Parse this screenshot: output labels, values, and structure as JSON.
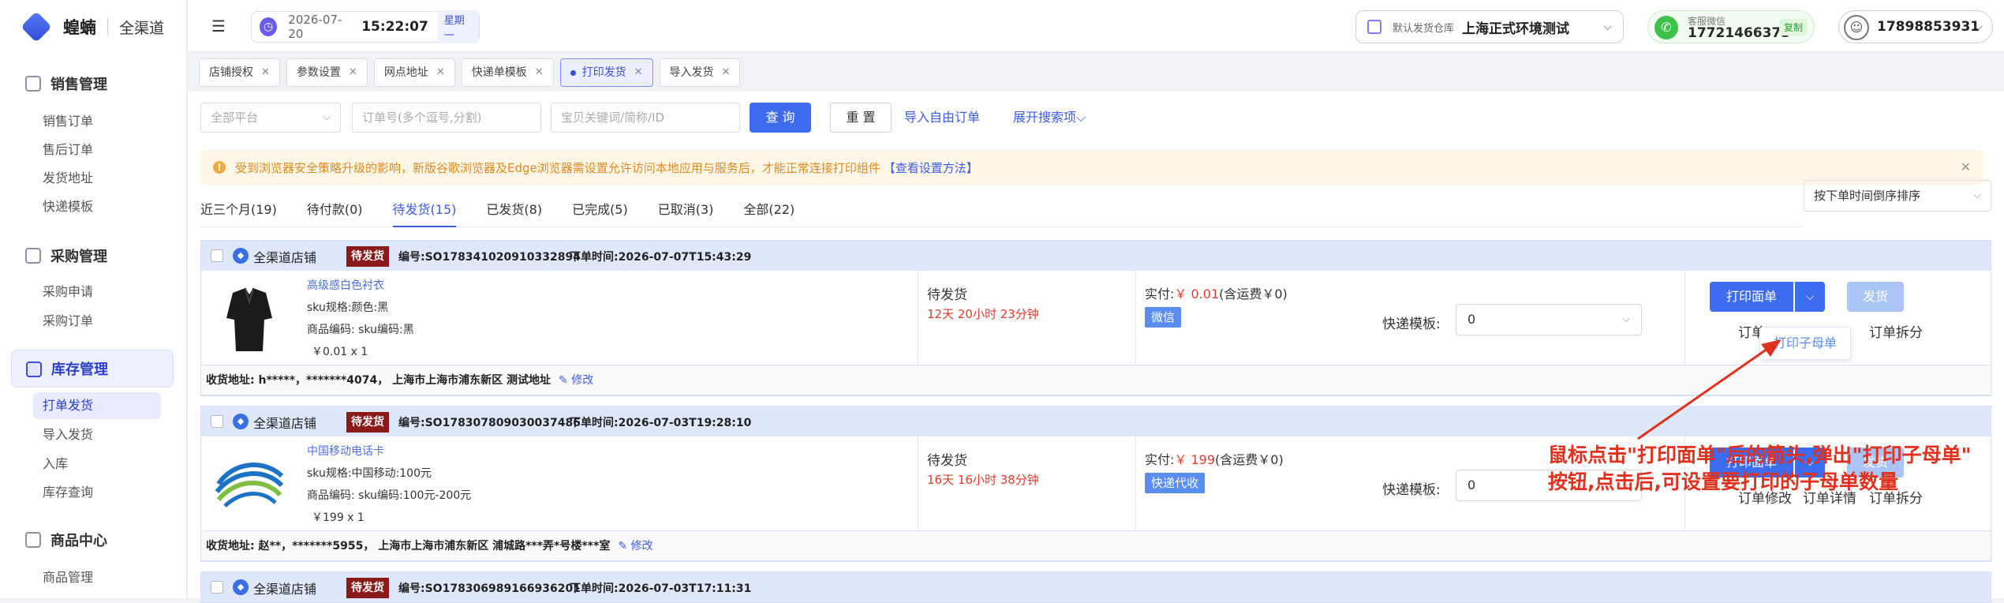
{
  "app": {
    "brand": "蝗蝻",
    "subtitle": "全渠道"
  },
  "sidebar": {
    "groups": [
      {
        "label": "销售管理",
        "items": [
          "销售订单",
          "售后订单",
          "发货地址",
          "快递模板"
        ]
      },
      {
        "label": "采购管理",
        "items": [
          "采购申请",
          "采购订单"
        ]
      },
      {
        "label": "库存管理",
        "items": [
          "打单发货",
          "导入发货",
          "入库",
          "库存查询"
        ]
      },
      {
        "label": "商品中心",
        "items": [
          "商品管理"
        ]
      }
    ]
  },
  "header": {
    "date": "2026-07-20",
    "time": "15:22:07",
    "weekday": "星期一",
    "warehouse_label": "默认发货仓库",
    "warehouse_value": "上海正式环境测试",
    "service_label": "客服微信",
    "service_value": "17721466375",
    "copy_label": "复制",
    "user": "17898853931"
  },
  "tabs": [
    {
      "label": "店铺授权",
      "active": false
    },
    {
      "label": "参数设置",
      "active": false
    },
    {
      "label": "网点地址",
      "active": false
    },
    {
      "label": "快递单模板",
      "active": false
    },
    {
      "label": "打印发货",
      "active": true
    },
    {
      "label": "导入发货",
      "active": false
    }
  ],
  "filters": {
    "platform_placeholder": "全部平台",
    "order_placeholder": "订单号(多个逗号,分割)",
    "product_placeholder": "宝贝关键词/简称/ID",
    "query_label": "查 询",
    "reset_label": "重 置",
    "import_link": "导入自由订单",
    "expand_link": "展开搜索项"
  },
  "notice": {
    "text": "受到浏览器安全策略升级的影响，新版谷歌浏览器及Edge浏览器需设置允许访问本地应用与服务后，才能正常连接打印组件",
    "link": "【查看设置方法】"
  },
  "order_tabs": [
    {
      "label": "近三个月(19)",
      "active": false
    },
    {
      "label": "待付款(0)",
      "active": false
    },
    {
      "label": "待发货(15)",
      "active": true
    },
    {
      "label": "已发货(8)",
      "active": false
    },
    {
      "label": "已完成(5)",
      "active": false
    },
    {
      "label": "已取消(3)",
      "active": false
    },
    {
      "label": "全部(22)",
      "active": false
    }
  ],
  "sort": {
    "value": "按下单时间倒序排序"
  },
  "orders": [
    {
      "shop": "全渠道店铺",
      "badge": "待发货",
      "order_no": "编号:SO178341020910332894",
      "order_time": "下单时间:2026-07-07T15:43:29",
      "product_name": "高级感白色衬衣",
      "sku": "sku规格:颜色:黑",
      "code": "商品编码:    sku编码:黑",
      "price": "￥0.01 x 1",
      "status": "待发货",
      "countdown": "12天 20小时 23分钟",
      "paid_prefix": "实付:",
      "paid_amount": "￥ 0.01",
      "paid_suffix": "(含运费￥0)",
      "pay_tag": "微信",
      "express_label": "快递模板:",
      "express_value": "0",
      "address": "收货地址: h*****，*******4074， 上海市上海市浦东新区 测试地址",
      "edit": "修改"
    },
    {
      "shop": "全渠道店铺",
      "badge": "待发货",
      "order_no": "编号:SO178307809030037486",
      "order_time": "下单时间:2026-07-03T19:28:10",
      "product_name": "中国移动电话卡",
      "sku": "sku规格:中国移动:100元",
      "code": "商品编码:    sku编码:100元-200元",
      "price": "￥199 x 1",
      "status": "待发货",
      "countdown": "16天 16小时 38分钟",
      "paid_prefix": "实付:",
      "paid_amount": "￥ 199",
      "paid_suffix": "(含运费￥0)",
      "pay_tag": "快递代收",
      "express_label": "快递模板:",
      "express_value": "0",
      "address": "收货地址: 赵**，*******5955， 上海市上海市浦东新区 浦城路***弄*号楼***室",
      "edit": "修改"
    },
    {
      "shop": "全渠道店铺",
      "badge": "待发货",
      "order_no": "编号:SO178306989166936201",
      "order_time": "下单时间:2026-07-03T17:11:31"
    }
  ],
  "actions": {
    "print_label": "打印面单",
    "ship_label": "发货",
    "order_label": "订单修改",
    "detail_label": "订单详情",
    "split_label": "订单拆分",
    "order_label_cut": "订单",
    "popup_label": "打印子母单"
  },
  "annotation": {
    "line1": "鼠标点击\"打印面单\"后的箭头,弹出\"打印子母单\"",
    "line2": "按钮,点击后,可设置要打印的子母单数量"
  },
  "colors": {
    "primary": "#3e6cf0",
    "danger": "#e03b2b",
    "badge": "#8b1a1a"
  }
}
